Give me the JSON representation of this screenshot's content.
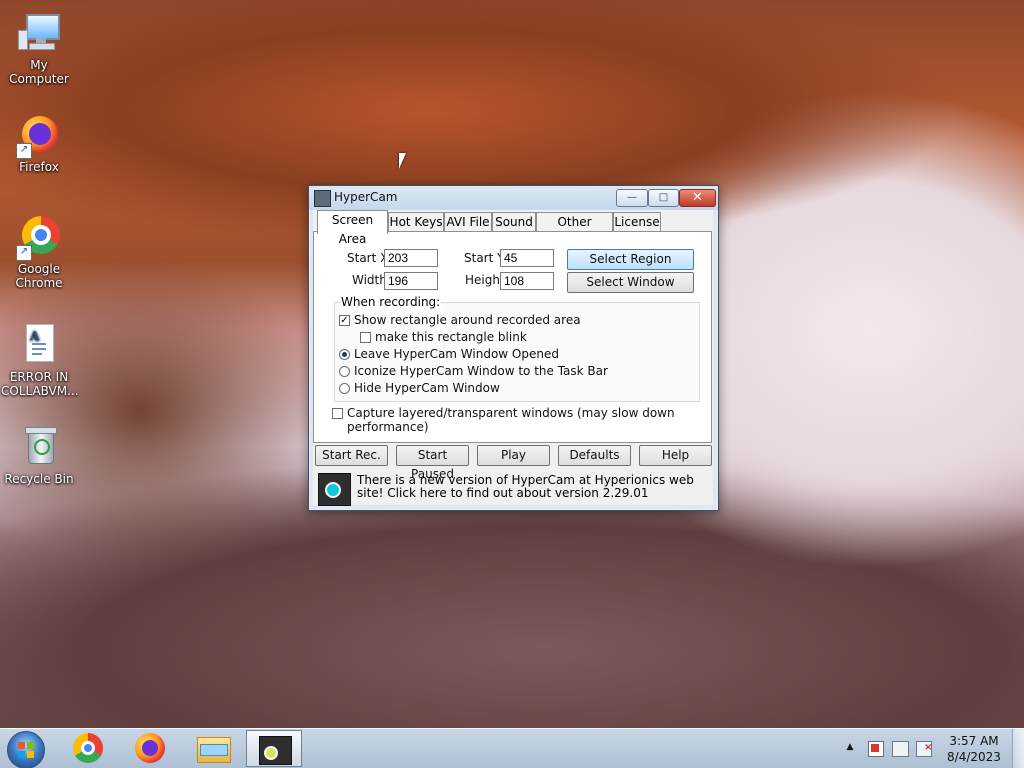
{
  "desktop": {
    "icons": [
      {
        "label": "My Computer",
        "icon": "computer-icon"
      },
      {
        "label": "Firefox",
        "icon": "firefox-icon"
      },
      {
        "label": "Google Chrome",
        "icon": "chrome-icon"
      },
      {
        "label": "ERROR IN COLLABVM...",
        "icon": "document-icon"
      },
      {
        "label": "Recycle Bin",
        "icon": "recycle-bin-icon"
      }
    ]
  },
  "window": {
    "title": "HyperCam",
    "controls": {
      "minimize": "—",
      "maximize": "□",
      "close": "✕"
    },
    "tabs": [
      "Screen Area",
      "Hot Keys",
      "AVI File",
      "Sound",
      "Other Options",
      "License"
    ],
    "active_tab": "Screen Area",
    "screen_area": {
      "start_x_label": "Start X",
      "start_x_value": "203",
      "start_y_label": "Start Y",
      "start_y_value": "45",
      "width_label": "Width",
      "width_value": "196",
      "height_label": "Height",
      "height_value": "108",
      "select_region": "Select Region",
      "select_window": "Select Window",
      "when_recording": "When recording:",
      "options": {
        "show_rectangle": "Show rectangle around recorded area",
        "blink": "make this rectangle blink",
        "leave_opened": "Leave HyperCam Window Opened",
        "iconize": "Iconize HyperCam Window to the Task Bar",
        "hide": "Hide HyperCam Window",
        "capture_layered": "Capture layered/transparent windows (may slow down performance)"
      },
      "states": {
        "show_rectangle": true,
        "blink": false,
        "radio_selected": "leave_opened",
        "capture_layered": false
      }
    },
    "buttons": {
      "start_rec": "Start Rec.",
      "start_paused": "Start Paused",
      "play": "Play",
      "defaults": "Defaults",
      "help": "Help"
    },
    "notice": "There is a new version of HyperCam at Hyperionics web site! Click here to find out about version 2.29.01"
  },
  "taskbar": {
    "pinned": [
      "start",
      "chrome",
      "firefox",
      "file-explorer",
      "hypercam"
    ],
    "tray": {
      "show_hidden": "▲",
      "time": "3:57 AM",
      "date": "8/4/2023"
    }
  }
}
